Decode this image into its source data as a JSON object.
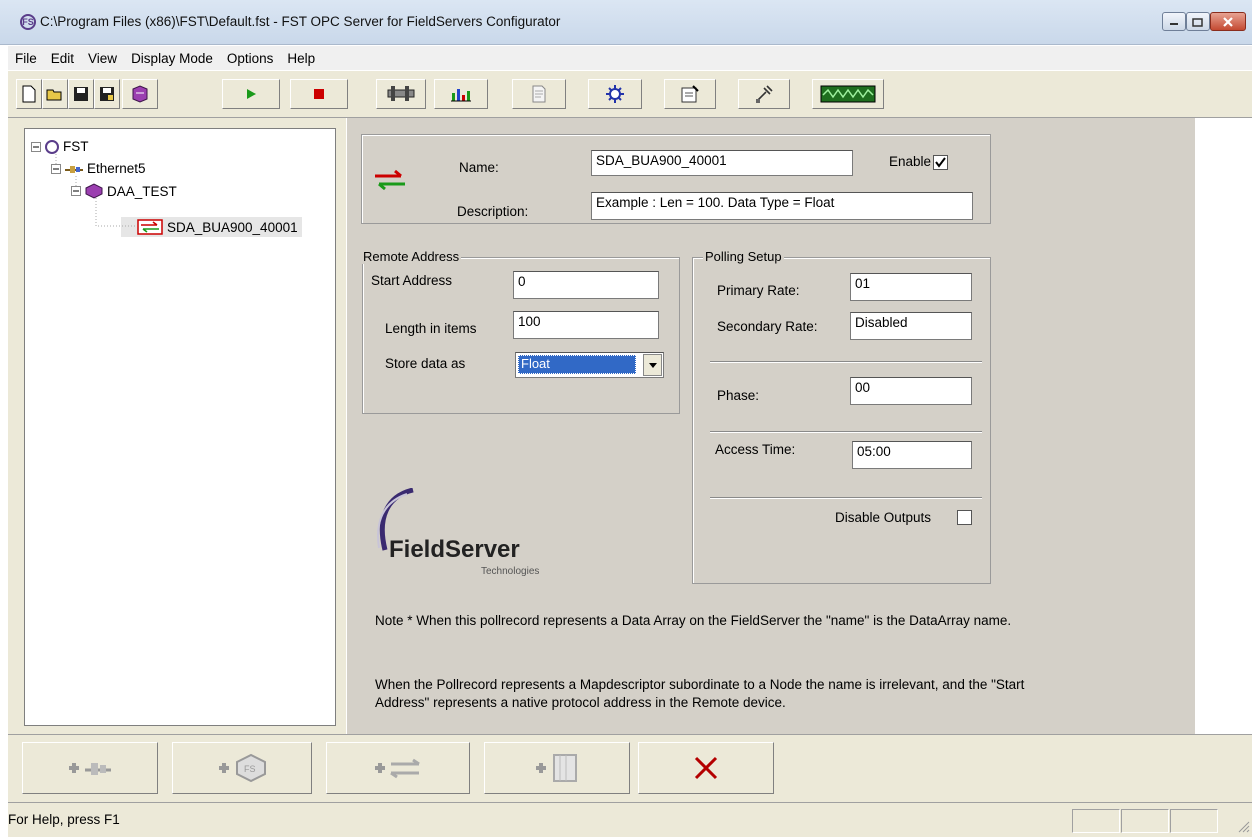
{
  "window": {
    "title": "C:\\Program Files (x86)\\FST\\Default.fst - FST OPC Server for FieldServers Configurator",
    "app_icon_letters": "FS"
  },
  "menu": [
    "File",
    "Edit",
    "View",
    "Display Mode",
    "Options",
    "Help"
  ],
  "toolbar": {
    "buttons": [
      "new-file",
      "open-folder",
      "save",
      "save-as",
      "book",
      "run",
      "stop",
      "settings",
      "chart",
      "document",
      "network",
      "properties",
      "probe",
      "signal"
    ]
  },
  "tree": {
    "root": "FST",
    "connection": "Ethernet5",
    "node": "DAA_TEST",
    "record": "SDA_BUA900_40001"
  },
  "form": {
    "name_label": "Name:",
    "name_value": "SDA_BUA900_40001",
    "enable_label": "Enable",
    "enable_checked": true,
    "description_label": "Description:",
    "description_value": "Example : Len = 100. Data Type = Float",
    "remote": {
      "group": "Remote Address",
      "start_label": "Start Address",
      "start_value": "0",
      "length_label": "Length in items",
      "length_value": "100",
      "store_label": "Store data as",
      "store_value": "Float"
    },
    "polling": {
      "group": "Polling Setup",
      "primary_label": "Primary Rate:",
      "primary_value": "01",
      "secondary_label": "Secondary Rate:",
      "secondary_value": "Disabled",
      "phase_label": "Phase:",
      "phase_value": "00",
      "access_label": "Access Time:",
      "access_value": "05:00",
      "disable_label": "Disable Outputs",
      "disable_checked": false
    },
    "logo": {
      "main": "FieldServer",
      "sub": "Technologies"
    },
    "note1": "Note * When this pollrecord represents a  Data Array on the FieldServer the \"name\" is the DataArray name.",
    "note2": "When the Pollrecord represents a Mapdescriptor  subordinate to a Node the name is irrelevant, and the \"Start Address\" represents a native protocol address in the  Remote device."
  },
  "bottom_buttons": [
    "add-connection",
    "add-node",
    "add-pollrecord",
    "add-module",
    "delete"
  ],
  "status": {
    "text": "For Help, press F1"
  },
  "colors": {
    "panel": "#d4d0c8",
    "toolbar": "#ece9d8",
    "accent_red": "#cc0000",
    "accent_green": "#1a9a1a",
    "purple": "#5a3d8a"
  }
}
